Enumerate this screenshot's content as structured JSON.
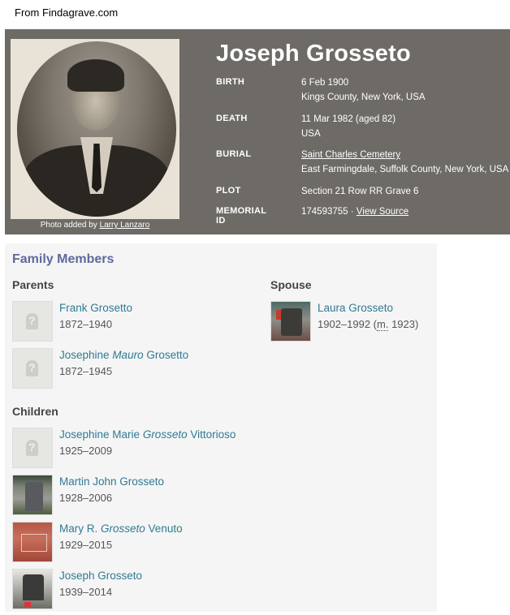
{
  "source_note": "From Findagrave.com",
  "memorial": {
    "name": "Joseph Grosseto",
    "photo_caption_prefix": "Photo added by ",
    "photo_caption_author": "Larry Lanzaro",
    "birth_label": "BIRTH",
    "birth_date": "6 Feb 1900",
    "birth_place": "Kings County, New York, USA",
    "death_label": "DEATH",
    "death_date": "11 Mar 1982 (aged 82)",
    "death_place": "USA",
    "burial_label": "BURIAL",
    "burial_cemetery": "Saint Charles Cemetery",
    "burial_place": "East Farmingdale, Suffolk County, New York, USA",
    "plot_label": "PLOT",
    "plot_value": "Section 21 Row RR Grave 6",
    "memorial_id_label": "MEMORIAL ID",
    "memorial_id_value": "174593755 · ",
    "view_source": "View Source"
  },
  "family": {
    "title": "Family Members",
    "parents_label": "Parents",
    "spouse_label": "Spouse",
    "children_label": "Children",
    "parents": [
      {
        "first": "Frank Grosetto",
        "maiden": "",
        "last": "",
        "dates": "1872–1940"
      },
      {
        "first": "Josephine ",
        "maiden": "Mauro",
        "last": " Grosetto",
        "dates": "1872–1945"
      }
    ],
    "spouse": {
      "name": "Laura Grosseto",
      "dates": "1902–1992 (",
      "married_abbr": "m.",
      "married_year": " 1923)"
    },
    "children": [
      {
        "first": "Josephine Marie ",
        "maiden": "Grosseto",
        "last": " Vittorioso",
        "dates": "1925–2009"
      },
      {
        "first": "Martin John Grosseto",
        "maiden": "",
        "last": "",
        "dates": "1928–2006"
      },
      {
        "first": "Mary R. ",
        "maiden": "Grosseto",
        "last": " Venuto",
        "dates": "1929–2015"
      },
      {
        "first": "Joseph Grosseto",
        "maiden": "",
        "last": "",
        "dates": "1939–2014"
      }
    ]
  }
}
